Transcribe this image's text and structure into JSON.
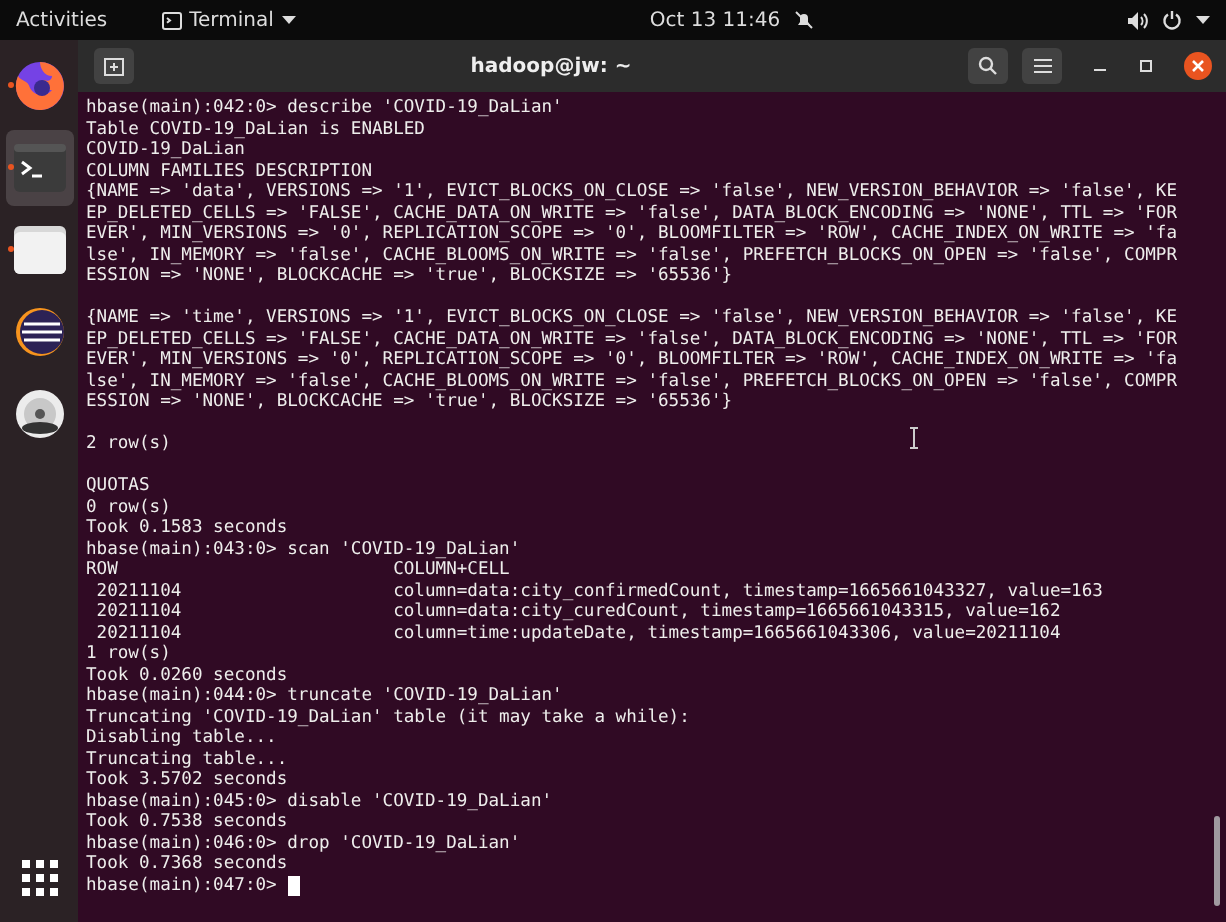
{
  "top_bar": {
    "activities": "Activities",
    "app_menu": "Terminal",
    "clock": "Oct 13  11:46"
  },
  "dock": [
    {
      "kind": "browser",
      "running": true,
      "selected": false
    },
    {
      "kind": "terminal",
      "running": true,
      "selected": true
    },
    {
      "kind": "files",
      "running": true,
      "selected": false
    },
    {
      "kind": "ide",
      "running": false,
      "selected": false
    },
    {
      "kind": "dvd",
      "running": false,
      "selected": false
    }
  ],
  "window": {
    "title": "hadoop@jw: ~"
  },
  "terminal": {
    "blocks": [
      [
        "hbase(main):042:0> describe 'COVID-19_DaLian'",
        "Table COVID-19_DaLian is ENABLED",
        "COVID-19_DaLian",
        "COLUMN FAMILIES DESCRIPTION",
        "{NAME => 'data', VERSIONS => '1', EVICT_BLOCKS_ON_CLOSE => 'false', NEW_VERSION_BEHAVIOR => 'false', KE",
        "EP_DELETED_CELLS => 'FALSE', CACHE_DATA_ON_WRITE => 'false', DATA_BLOCK_ENCODING => 'NONE', TTL => 'FOR",
        "EVER', MIN_VERSIONS => '0', REPLICATION_SCOPE => '0', BLOOMFILTER => 'ROW', CACHE_INDEX_ON_WRITE => 'fa",
        "lse', IN_MEMORY => 'false', CACHE_BLOOMS_ON_WRITE => 'false', PREFETCH_BLOCKS_ON_OPEN => 'false', COMPR",
        "ESSION => 'NONE', BLOCKCACHE => 'true', BLOCKSIZE => '65536'}"
      ],
      [
        "{NAME => 'time', VERSIONS => '1', EVICT_BLOCKS_ON_CLOSE => 'false', NEW_VERSION_BEHAVIOR => 'false', KE",
        "EP_DELETED_CELLS => 'FALSE', CACHE_DATA_ON_WRITE => 'false', DATA_BLOCK_ENCODING => 'NONE', TTL => 'FOR",
        "EVER', MIN_VERSIONS => '0', REPLICATION_SCOPE => '0', BLOOMFILTER => 'ROW', CACHE_INDEX_ON_WRITE => 'fa",
        "lse', IN_MEMORY => 'false', CACHE_BLOOMS_ON_WRITE => 'false', PREFETCH_BLOCKS_ON_OPEN => 'false', COMPR",
        "ESSION => 'NONE', BLOCKCACHE => 'true', BLOCKSIZE => '65536'}"
      ],
      [
        "2 row(s)"
      ],
      [
        "QUOTAS",
        "0 row(s)",
        "Took 0.1583 seconds",
        "hbase(main):043:0> scan 'COVID-19_DaLian'",
        "ROW                          COLUMN+CELL",
        " 20211104                    column=data:city_confirmedCount, timestamp=1665661043327, value=163",
        " 20211104                    column=data:city_curedCount, timestamp=1665661043315, value=162",
        " 20211104                    column=time:updateDate, timestamp=1665661043306, value=20211104",
        "1 row(s)",
        "Took 0.0260 seconds",
        "hbase(main):044:0> truncate 'COVID-19_DaLian'",
        "Truncating 'COVID-19_DaLian' table (it may take a while):",
        "Disabling table...",
        "Truncating table...",
        "Took 3.5702 seconds",
        "hbase(main):045:0> disable 'COVID-19_DaLian'",
        "Took 0.7538 seconds",
        "hbase(main):046:0> drop 'COVID-19_DaLian'",
        "Took 0.7368 seconds",
        "hbase(main):047:0> "
      ]
    ]
  }
}
